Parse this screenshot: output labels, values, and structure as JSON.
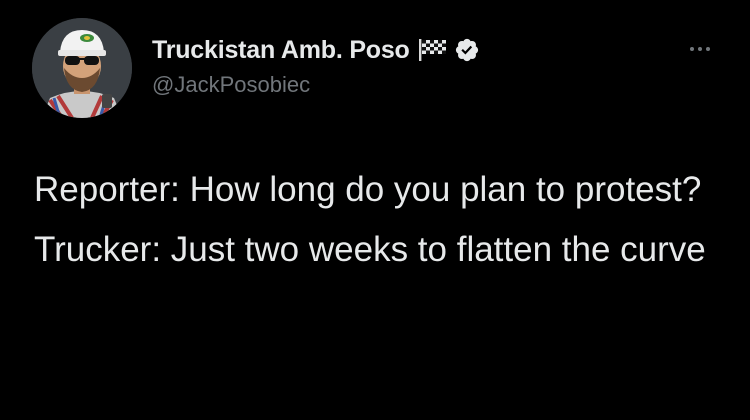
{
  "author": {
    "display_name": "Truckistan Amb. Poso",
    "handle": "@JackPosobiec",
    "flag_icon": "checkered-flag-icon",
    "verified_icon": "verified-badge-icon",
    "verified_color": "#e7e9ea"
  },
  "menu": {
    "icon": "more-options-icon"
  },
  "tweet": {
    "paragraphs": [
      "Reporter: How long do you plan to protest?",
      "Trucker: Just two weeks to flatten the curve"
    ]
  },
  "colors": {
    "background": "#000000",
    "primary_text": "#e7e9ea",
    "secondary_text": "#71767b"
  }
}
